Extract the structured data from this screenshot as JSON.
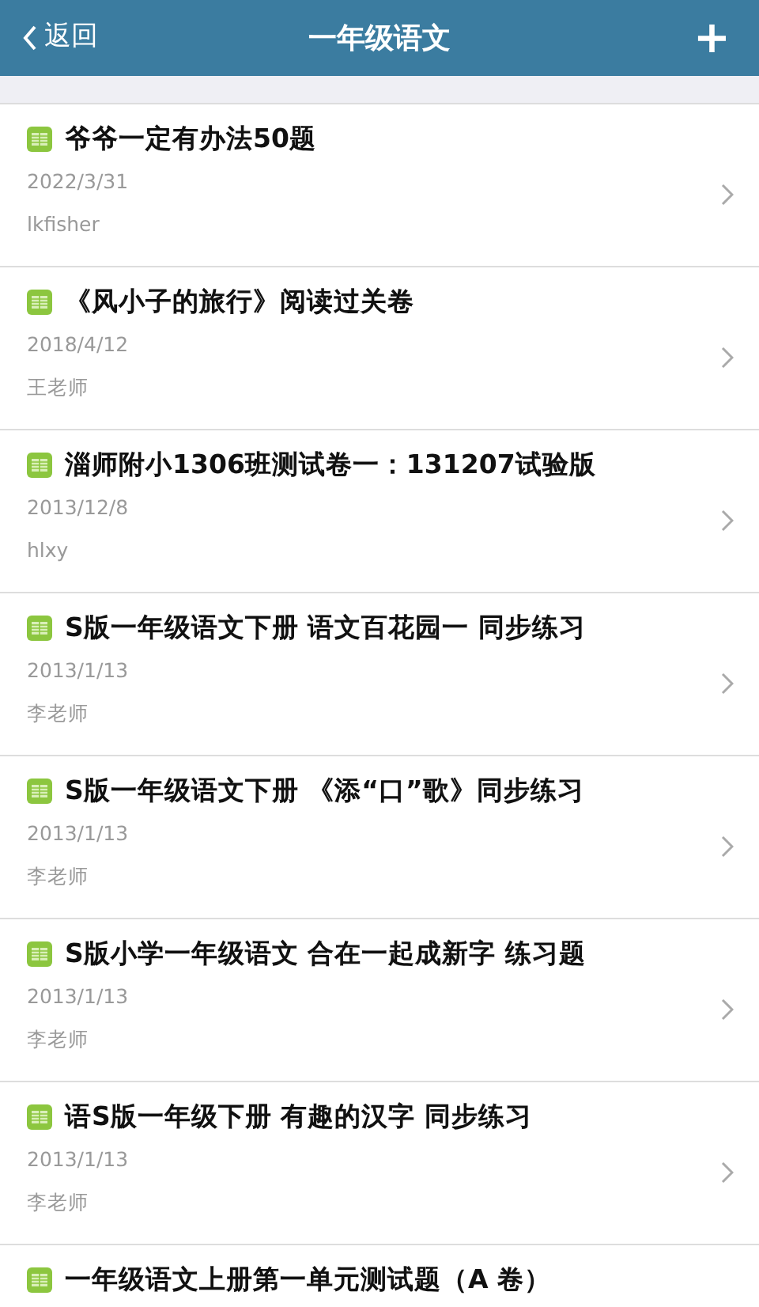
{
  "header": {
    "back": "返回",
    "title": "一年级语文",
    "add": "+"
  },
  "items": [
    {
      "title": "爷爷一定有办法50题",
      "date": "2022/3/31",
      "author": "lkfisher"
    },
    {
      "title": "《风小子的旅行》阅读过关卷",
      "date": "2018/4/12",
      "author": "王老师"
    },
    {
      "title": "淄师附小1306班测试卷一：131207试验版",
      "date": "2013/12/8",
      "author": "hlxy"
    },
    {
      "title": "S版一年级语文下册 语文百花园一 同步练习",
      "date": "2013/1/13",
      "author": "李老师"
    },
    {
      "title": "S版一年级语文下册 《添“口”歌》同步练习",
      "date": "2013/1/13",
      "author": "李老师"
    },
    {
      "title": "S版小学一年级语文 合在一起成新字 练习题",
      "date": "2013/1/13",
      "author": "李老师"
    },
    {
      "title": "语S版一年级下册 有趣的汉字 同步练习",
      "date": "2013/1/13",
      "author": "李老师"
    },
    {
      "title": "一年级语文上册第一单元测试题（A 卷）"
    }
  ]
}
